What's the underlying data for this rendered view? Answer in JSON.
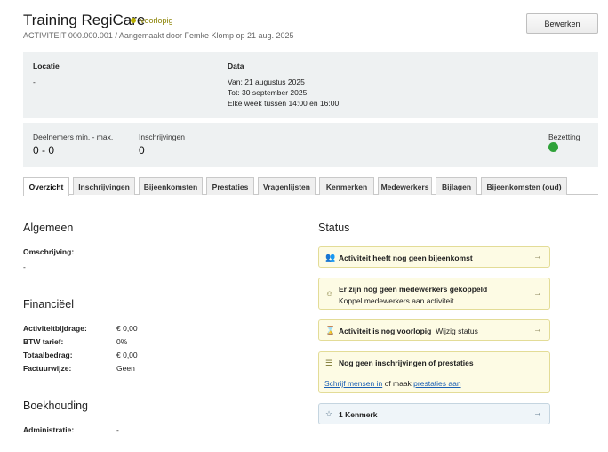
{
  "header": {
    "title": "Training RegiCare",
    "status": "voorlopig",
    "subtitle": "ACTIVITEIT 000.000.001 / Aangemaakt door Femke Klomp op 21 aug. 2025",
    "edit_label": "Bewerken"
  },
  "info": {
    "locatie_label": "Locatie",
    "locatie_value": "-",
    "data_label": "Data",
    "data_van": "Van: 21 augustus 2025",
    "data_tot": "Tot: 30 september 2025",
    "data_week": "Elke week tussen 14:00 en 16:00"
  },
  "stats": {
    "deelnemers_label": "Deelnemers min. - max.",
    "deelnemers_value": "0 - 0",
    "inschrijvingen_label": "Inschrijvingen",
    "inschrijvingen_value": "0",
    "bezetting_label": "Bezetting",
    "bezetting_color": "#2fa23a"
  },
  "tabs": [
    {
      "label": "Overzicht"
    },
    {
      "label": "Inschrijvingen"
    },
    {
      "label": "Bijeenkomsten"
    },
    {
      "label": "Prestaties"
    },
    {
      "label": "Vragenlijsten"
    },
    {
      "label": "Kenmerken"
    },
    {
      "label": "Medewerkers"
    },
    {
      "label": "Bijlagen"
    },
    {
      "label": "Bijeenkomsten (oud)"
    }
  ],
  "algemeen": {
    "heading": "Algemeen",
    "omschrijving_label": "Omschrijving:",
    "omschrijving_value": "-"
  },
  "financieel": {
    "heading": "Financiëel",
    "rows": [
      {
        "label": "Activiteitbijdrage:",
        "value": "€ 0,00"
      },
      {
        "label": "BTW tarief:",
        "value": "0%"
      },
      {
        "label": "Totaalbedrag:",
        "value": "€ 0,00"
      },
      {
        "label": "Factuurwijze:",
        "value": "Geen"
      }
    ]
  },
  "boekhouding": {
    "heading": "Boekhouding",
    "administratie_label": "Administratie:",
    "administratie_value": "-"
  },
  "status": {
    "heading": "Status",
    "cards": [
      {
        "title": "Activiteit heeft nog geen bijeenkomst",
        "icon": "users-icon"
      },
      {
        "title": "Er zijn nog geen medewerkers gekoppeld",
        "sub": "Koppel medewerkers aan activiteit",
        "icon": "user-icon"
      },
      {
        "title": "Activiteit is nog voorlopig",
        "extra": "Wijzig status",
        "icon": "hourglass-icon"
      },
      {
        "title": "Nog geen inschrijvingen of prestaties",
        "link1": "Schrijf mensen in",
        "mid": " of maak ",
        "link2": "prestaties aan",
        "icon": "list-icon"
      },
      {
        "title": "1 Kenmerk",
        "icon": "tag-icon"
      }
    ]
  }
}
